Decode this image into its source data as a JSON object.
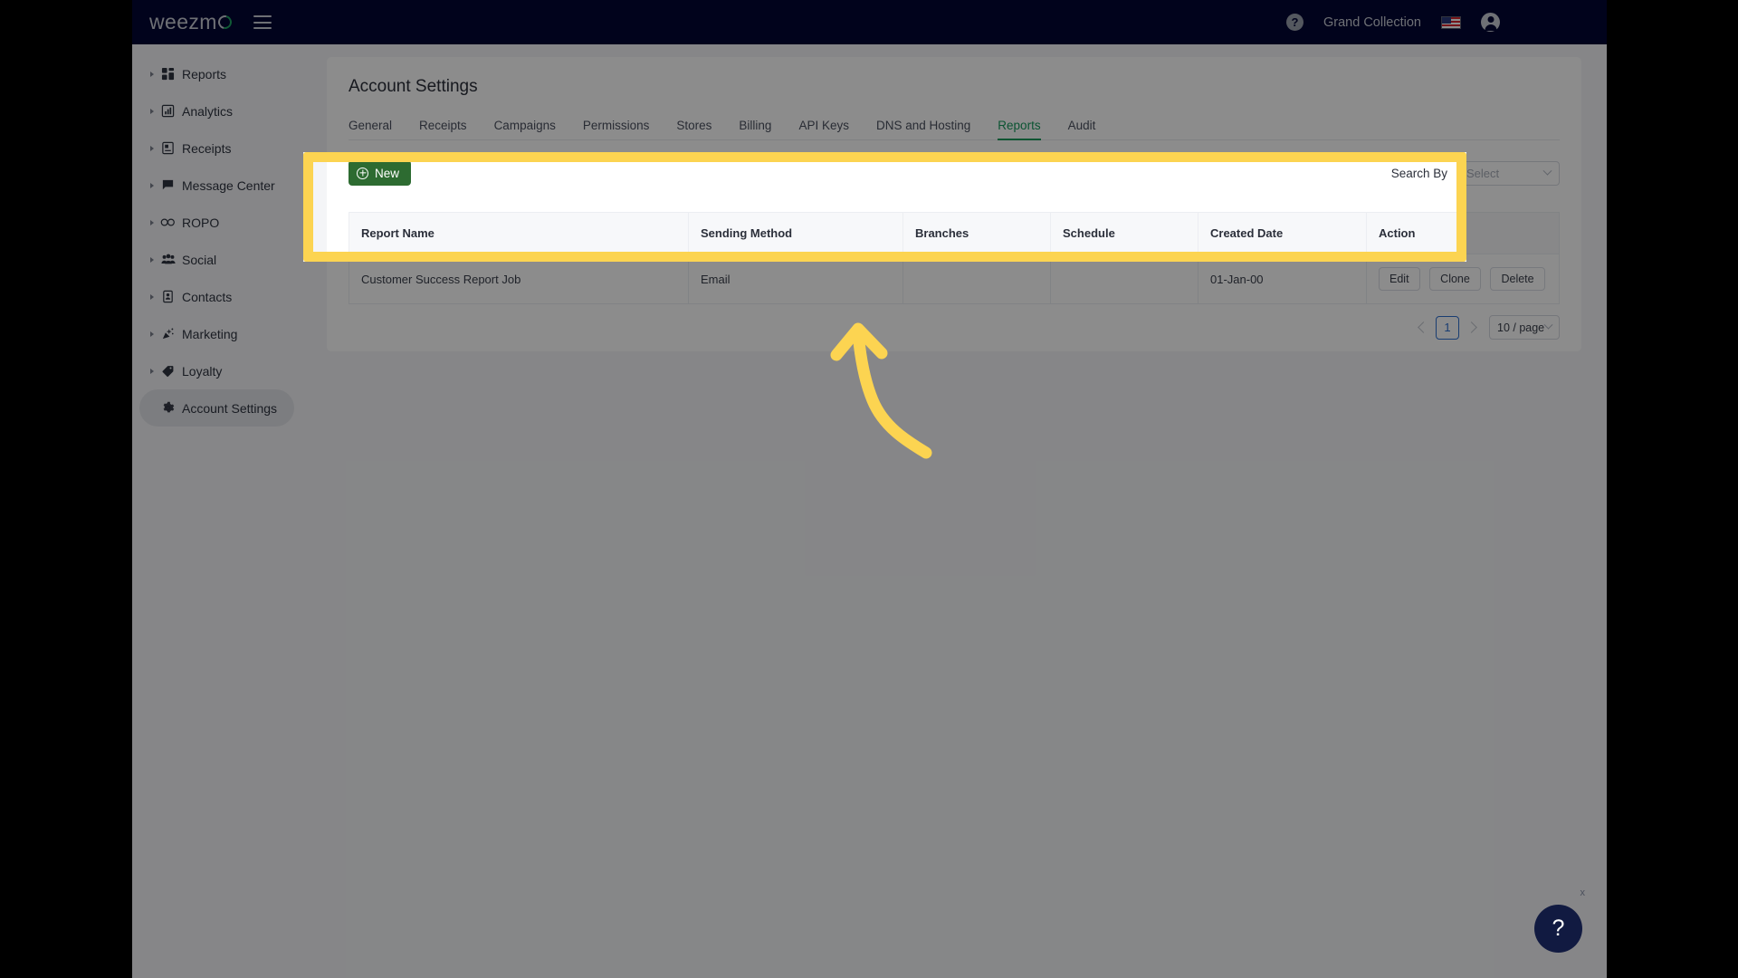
{
  "navbar": {
    "logo_text": "weezm",
    "menu_icon": "hamburger-icon",
    "help_icon": "?",
    "account_name": "Grand Collection",
    "flag_icon": "us-flag-icon",
    "avatar_icon": "user-avatar-icon"
  },
  "sidebar": {
    "items": [
      {
        "label": "Reports",
        "icon": "dashboard-grid-icon",
        "expandable": true,
        "active": false
      },
      {
        "label": "Analytics",
        "icon": "bar-chart-icon",
        "expandable": true,
        "active": false
      },
      {
        "label": "Receipts",
        "icon": "receipt-icon",
        "expandable": true,
        "active": false
      },
      {
        "label": "Message Center",
        "icon": "message-flag-icon",
        "expandable": true,
        "active": false
      },
      {
        "label": "ROPO",
        "icon": "infinity-icon",
        "expandable": true,
        "active": false
      },
      {
        "label": "Social",
        "icon": "people-group-icon",
        "expandable": true,
        "active": false
      },
      {
        "label": "Contacts",
        "icon": "contact-card-icon",
        "expandable": true,
        "active": false
      },
      {
        "label": "Marketing",
        "icon": "megaphone-icon",
        "expandable": true,
        "active": false
      },
      {
        "label": "Loyalty",
        "icon": "tag-icon",
        "expandable": true,
        "active": false
      },
      {
        "label": "Account Settings",
        "icon": "gear-icon",
        "expandable": false,
        "active": true
      }
    ]
  },
  "main": {
    "page_title": "Account Settings",
    "tabs": [
      {
        "label": "General",
        "active": false
      },
      {
        "label": "Receipts",
        "active": false
      },
      {
        "label": "Campaigns",
        "active": false
      },
      {
        "label": "Permissions",
        "active": false
      },
      {
        "label": "Stores",
        "active": false
      },
      {
        "label": "Billing",
        "active": false
      },
      {
        "label": "API Keys",
        "active": false
      },
      {
        "label": "DNS and Hosting",
        "active": false
      },
      {
        "label": "Reports",
        "active": true
      },
      {
        "label": "Audit",
        "active": false
      }
    ],
    "toolbar": {
      "new_label": "New",
      "new_icon": "plus-circle-icon",
      "search_label": "Search By",
      "search_placeholder": "Select",
      "search_chevron": "chevron-down-icon"
    },
    "table": {
      "columns": [
        "Report Name",
        "Sending Method",
        "Branches",
        "Schedule",
        "Created Date",
        "Action"
      ],
      "rows": [
        {
          "report_name": "Customer Success Report Job",
          "sending_method": "Email",
          "branches": "",
          "schedule": "",
          "created_date": "01-Jan-00",
          "actions": [
            "Edit",
            "Clone",
            "Delete"
          ]
        }
      ]
    },
    "pagination": {
      "prev_icon": "chevron-left-icon",
      "current_page": "1",
      "next_icon": "chevron-right-icon",
      "page_size": "10 / page",
      "page_size_chevron": "chevron-down-icon"
    }
  },
  "annotation": {
    "highlight_color": "#fcd451",
    "arrow_icon": "curved-up-arrow-annotation"
  },
  "help_widget": {
    "icon": "?",
    "close_label": "x",
    "color": "#111a41"
  },
  "colors": {
    "navbar_bg": "#020634",
    "accent_green": "#159a5c",
    "new_button_green": "#2d6b31",
    "pagination_blue": "#2f6fd0",
    "highlight_yellow": "#fcd451"
  }
}
